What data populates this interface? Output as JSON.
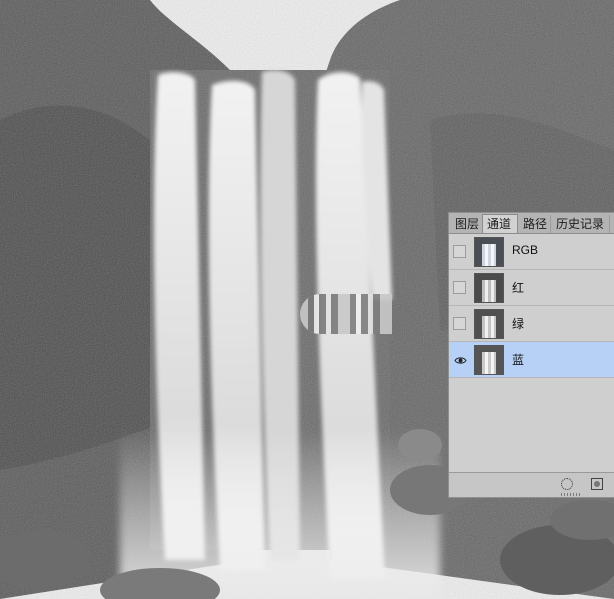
{
  "panel": {
    "tabs": [
      {
        "label": "图层"
      },
      {
        "label": "通道"
      },
      {
        "label": "路径"
      },
      {
        "label": "历史记录"
      }
    ],
    "active_tab": "通道",
    "channels": [
      {
        "name": "RGB",
        "visible": false,
        "selected": false
      },
      {
        "name": "红",
        "visible": false,
        "selected": false
      },
      {
        "name": "绿",
        "visible": false,
        "selected": false
      },
      {
        "name": "蓝",
        "visible": true,
        "selected": true
      }
    ],
    "footer_icons": [
      "load-selection-icon",
      "save-selection-icon"
    ]
  },
  "colors": {
    "selected_row": "#b7d0f6",
    "panel_bg": "#cfcfcf"
  }
}
